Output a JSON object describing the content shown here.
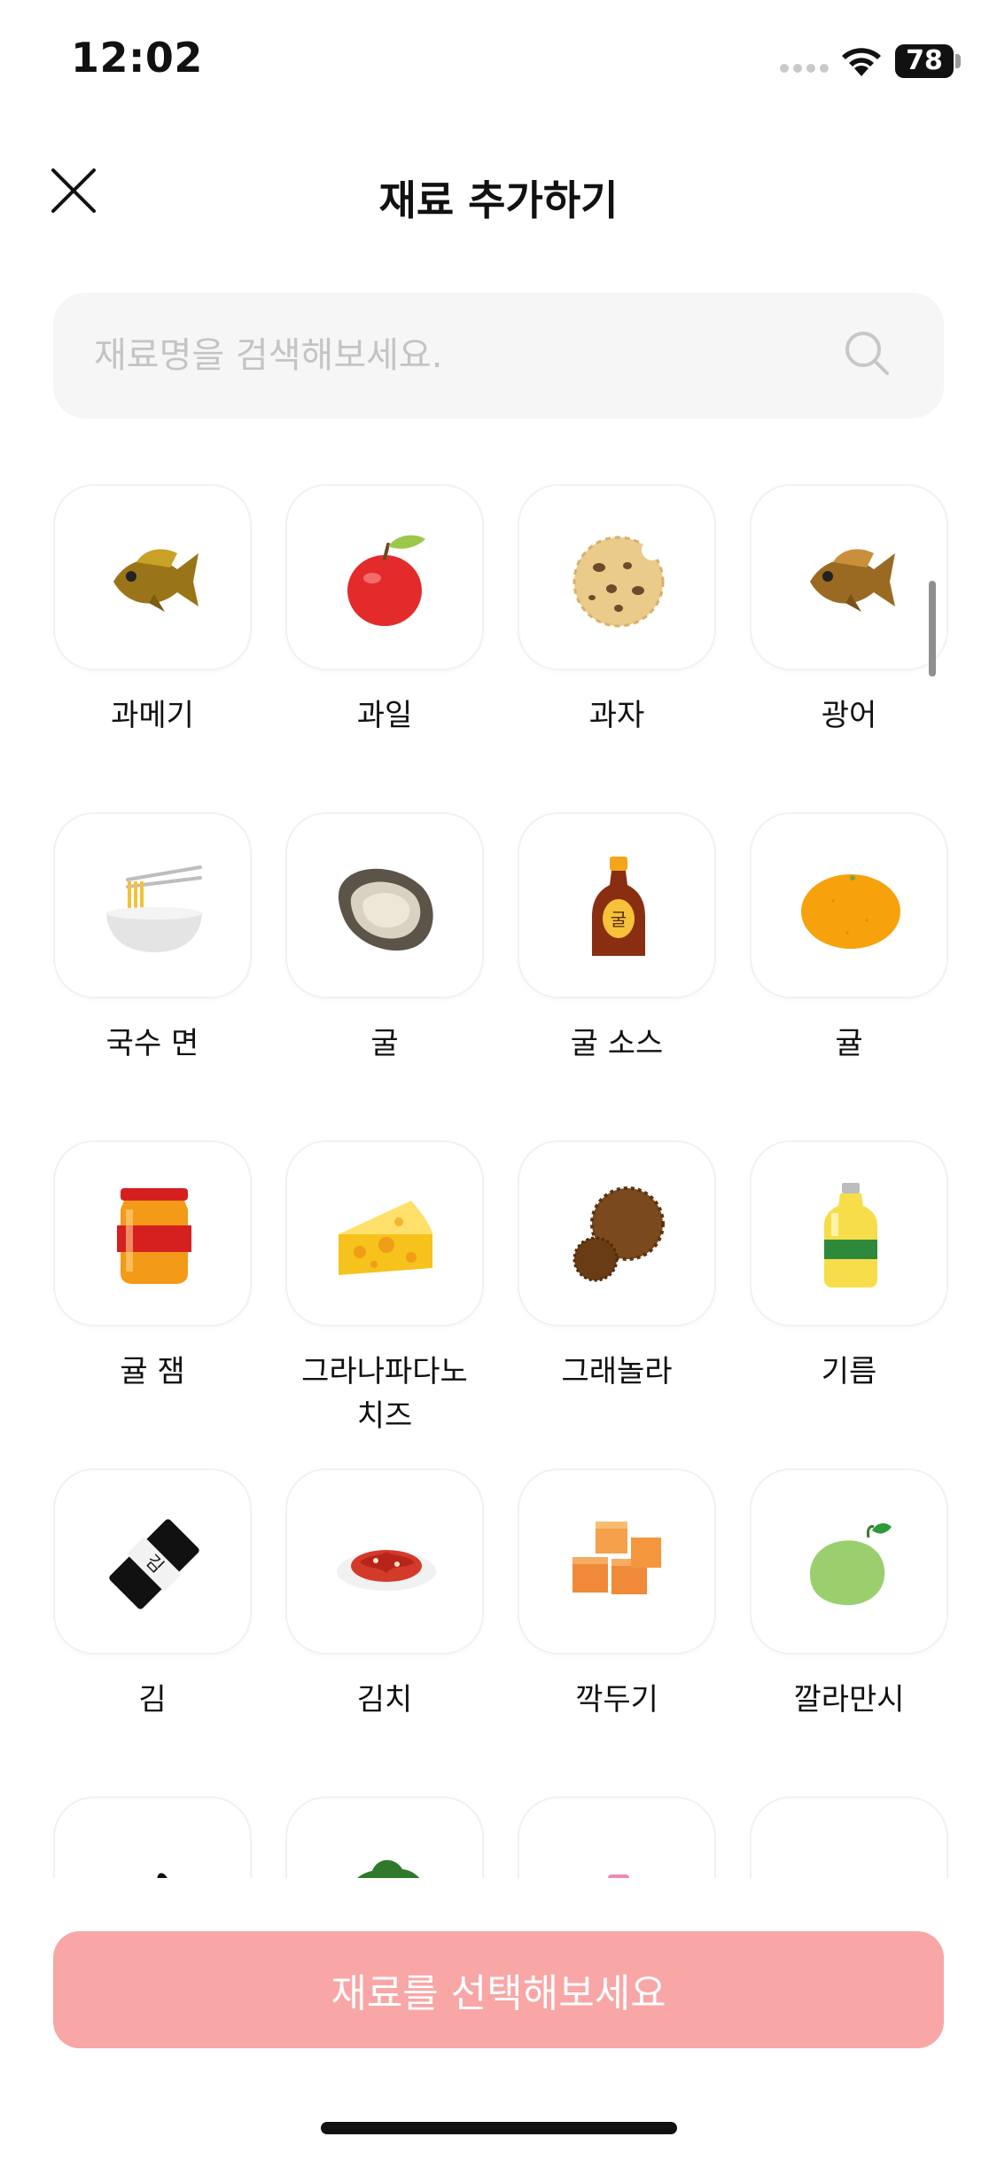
{
  "status_bar": {
    "time": "12:02",
    "battery": "78"
  },
  "header": {
    "title": "재료 추가하기",
    "close_icon": "close-icon"
  },
  "search": {
    "placeholder": "재료명을 검색해보세요.",
    "value": "",
    "icon": "search-icon"
  },
  "ingredients": [
    {
      "label": "과메기",
      "icon": "fish-icon"
    },
    {
      "label": "과일",
      "icon": "apple-icon"
    },
    {
      "label": "과자",
      "icon": "cookie-icon"
    },
    {
      "label": "광어",
      "icon": "fish-icon"
    },
    {
      "label": "국수 면",
      "icon": "noodle-bowl-icon"
    },
    {
      "label": "굴",
      "icon": "oyster-icon"
    },
    {
      "label": "굴 소스",
      "icon": "oyster-sauce-icon"
    },
    {
      "label": "귤",
      "icon": "tangerine-icon"
    },
    {
      "label": "귤 잼",
      "icon": "jam-jar-icon"
    },
    {
      "label": "그라나파다노 치즈",
      "icon": "cheese-icon"
    },
    {
      "label": "그래놀라",
      "icon": "granola-icon"
    },
    {
      "label": "기름",
      "icon": "oil-bottle-icon"
    },
    {
      "label": "김",
      "icon": "seaweed-icon"
    },
    {
      "label": "김치",
      "icon": "kimchi-icon"
    },
    {
      "label": "깍두기",
      "icon": "kkakdugi-icon"
    },
    {
      "label": "깔라만시",
      "icon": "calamansi-icon"
    },
    {
      "label": "",
      "icon": "sesame-icon"
    },
    {
      "label": "",
      "icon": "lettuce-icon"
    },
    {
      "label": "",
      "icon": "bag-icon"
    },
    {
      "label": "",
      "icon": "pot-icon"
    }
  ],
  "cta": {
    "label": "재료를 선택해보세요"
  },
  "colors": {
    "cta": "#f9a6a6",
    "search_bg": "#f6f6f6",
    "tile_border": "#f1f1f1"
  }
}
